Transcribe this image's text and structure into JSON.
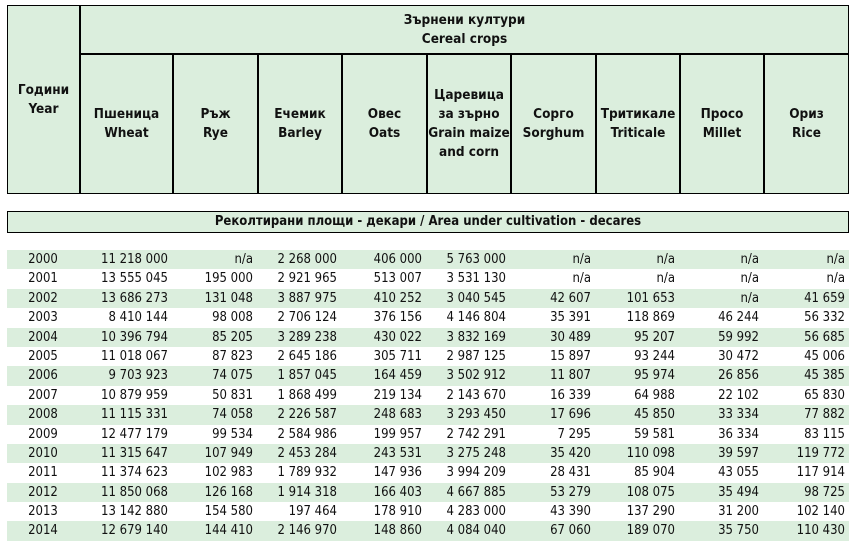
{
  "header": {
    "years_bg": "Години",
    "years_en": "Year",
    "group_bg": "Зърнени култури",
    "group_en": "Cereal crops",
    "crops": [
      {
        "bg": "Пшеница",
        "en": "Wheat"
      },
      {
        "bg": "Ръж",
        "en": "Rye"
      },
      {
        "bg": "Ечемик",
        "en": "Barley"
      },
      {
        "bg": "Овес",
        "en": "Oats"
      },
      {
        "bg": "Царевица",
        "bg2": "за зърно",
        "en": "Grain maize",
        "en2": "and corn"
      },
      {
        "bg": "Сорго",
        "en": "Sorghum"
      },
      {
        "bg": "Тритикале",
        "en": "Triticale"
      },
      {
        "bg": "Просо",
        "en": "Millet"
      },
      {
        "bg": "Ориз",
        "en": "Rice"
      }
    ]
  },
  "section_title": "Реколтирани площи - декари / Area under cultivation - decares",
  "colors": {
    "header_fill": "#dbeedd",
    "border": "#000000"
  },
  "rows": [
    {
      "year": "2000",
      "v": [
        "11 218 000",
        "n/a",
        "2 268 000",
        "406 000",
        "5 763 000",
        "n/a",
        "n/a",
        "n/a",
        "n/a"
      ]
    },
    {
      "year": "2001",
      "v": [
        "13 555 045",
        "195 000",
        "2 921 965",
        "513 007",
        "3 531 130",
        "n/a",
        "n/a",
        "n/a",
        "n/a"
      ]
    },
    {
      "year": "2002",
      "v": [
        "13 686 273",
        "131 048",
        "3 887 975",
        "410 252",
        "3 040 545",
        "42 607",
        "101 653",
        "n/a",
        "41 659"
      ]
    },
    {
      "year": "2003",
      "v": [
        "8 410 144",
        "98 008",
        "2 706 124",
        "376 156",
        "4 146 804",
        "35 391",
        "118 869",
        "46 244",
        "56 332"
      ]
    },
    {
      "year": "2004",
      "v": [
        "10 396 794",
        "85 205",
        "3 289 238",
        "430 022",
        "3 832 169",
        "30 489",
        "95 207",
        "59 992",
        "56 685"
      ]
    },
    {
      "year": "2005",
      "v": [
        "11 018 067",
        "87 823",
        "2 645 186",
        "305 711",
        "2 987 125",
        "15 897",
        "93 244",
        "30 472",
        "45 006"
      ]
    },
    {
      "year": "2006",
      "v": [
        "9 703 923",
        "74 075",
        "1 857 045",
        "164 459",
        "3 502 912",
        "11 807",
        "95 974",
        "26 856",
        "45 385"
      ]
    },
    {
      "year": "2007",
      "v": [
        "10 879 959",
        "50 831",
        "1 868 499",
        "219 134",
        "2 143 670",
        "16 339",
        "64 988",
        "22 102",
        "65 830"
      ]
    },
    {
      "year": "2008",
      "v": [
        "11 115 331",
        "74 058",
        "2 226 587",
        "248 683",
        "3 293 450",
        "17 696",
        "45 850",
        "33 334",
        "77 882"
      ]
    },
    {
      "year": "2009",
      "v": [
        "12 477 179",
        "99 534",
        "2 584 986",
        "199 957",
        "2 742 291",
        "7 295",
        "59 581",
        "36 334",
        "83 115"
      ]
    },
    {
      "year": "2010",
      "v": [
        "11 315 647",
        "107 949",
        "2 453 284",
        "243 531",
        "3 275 248",
        "35 420",
        "110 098",
        "39 597",
        "119 772"
      ]
    },
    {
      "year": "2011",
      "v": [
        "11 374 623",
        "102 983",
        "1 789 932",
        "147 936",
        "3 994 209",
        "28 431",
        "85 904",
        "43 055",
        "117 914"
      ]
    },
    {
      "year": "2012",
      "v": [
        "11 850 068",
        "126 168",
        "1 914 318",
        "166 403",
        "4 667 885",
        "53 279",
        "108 075",
        "35 494",
        "98 725"
      ]
    },
    {
      "year": "2013",
      "v": [
        "13 142 880",
        "154 580",
        "197 464",
        "178 910",
        "4 283 000",
        "43 390",
        "137 290",
        "31 200",
        "102 140"
      ]
    },
    {
      "year": "2014",
      "v": [
        "12 679 140",
        "144 410",
        "2 146 970",
        "148 860",
        "4 084 040",
        "67 060",
        "189 070",
        "35 750",
        "110 430"
      ]
    }
  ]
}
